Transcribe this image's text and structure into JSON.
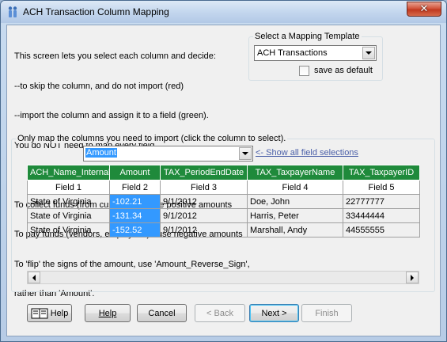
{
  "window": {
    "title": "ACH Transaction Column Mapping",
    "close_glyph": "✕"
  },
  "instructions": [
    "This screen lets you select each column and decide:",
    "--to skip the column, and do not import (red)",
    "--import the column and assign it to a field (green).",
    "You do NOT need to map every field",
    "",
    "To collect funds (from customers) - use positive amounts",
    "To pay funds (vendors, employees) - use negative amounts",
    "To 'flip' the signs of the amount, use 'Amount_Reverse_Sign',",
    "rather than 'Amount'."
  ],
  "template": {
    "legend": "Select a Mapping Template",
    "selected": "ACH Transactions",
    "save_default_label": "save as default",
    "save_default_checked": false
  },
  "mapping": {
    "legend": "Only map the columns you need to import (click the column to select).",
    "field_selected": "Amount",
    "show_all_link": "<- Show all field selections"
  },
  "grid": {
    "headers": [
      "ACH_Name_Internal",
      "Amount",
      "TAX_PeriodEndDate",
      "TAX_TaxpayerName",
      "TAX_TaxpayerID"
    ],
    "fields": [
      "Field 1",
      "Field 2",
      "Field 3",
      "Field 4",
      "Field 5"
    ],
    "rows": [
      [
        "State of Virginia",
        "-102.21",
        "9/1/2012",
        "Doe, John",
        "22777777"
      ],
      [
        "State of Virginia",
        "-131.34",
        "9/1/2012",
        "Harris, Peter",
        "33444444"
      ],
      [
        "State of Virginia",
        "-152.52",
        "9/1/2012",
        "Marshall, Andy",
        "44555555"
      ]
    ],
    "selected_column": 1,
    "colors": {
      "mapped_header": "#1f8a3b",
      "selected_cell": "#3399ff"
    }
  },
  "buttons": {
    "help_icon": "Help",
    "help": "Help",
    "cancel": "Cancel",
    "back": "< Back",
    "next": "Next >",
    "finish": "Finish"
  },
  "icons": [
    "app-icon",
    "close-icon",
    "dropdown-arrow-icon",
    "help-book-icon",
    "scroll-left-icon",
    "scroll-right-icon"
  ]
}
